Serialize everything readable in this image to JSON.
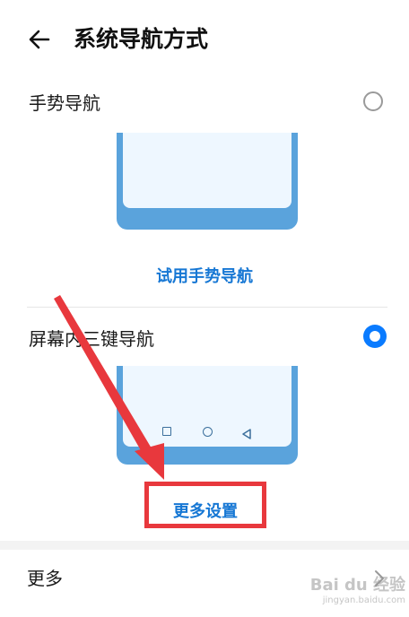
{
  "header": {
    "title": "系统导航方式",
    "back_icon": "back-arrow-icon"
  },
  "options": {
    "gesture": {
      "label": "手势导航",
      "selected": false,
      "try_link": "试用手势导航"
    },
    "three_key": {
      "label": "屏幕内三键导航",
      "selected": true,
      "more_settings": "更多设置"
    }
  },
  "more": {
    "label": "更多"
  },
  "annotation": {
    "color": "#e8383d"
  },
  "watermark": {
    "text": "Bai du 经验",
    "sub": "jingyan.baidu.com"
  },
  "colors": {
    "accent": "#1677d4",
    "radio_selected": "#0a7bff",
    "phone_frame": "#5aa3dc"
  }
}
